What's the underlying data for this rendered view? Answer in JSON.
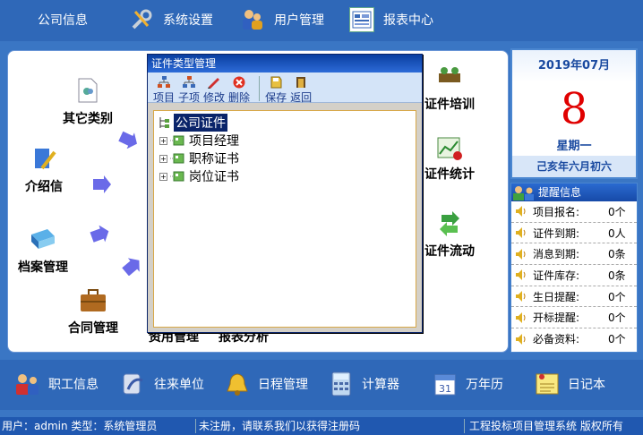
{
  "topnav": [
    {
      "label": "公司信息"
    },
    {
      "label": "系统设置"
    },
    {
      "label": "用户管理"
    },
    {
      "label": "报表中心"
    }
  ],
  "main": {
    "left_items": [
      {
        "label": "其它类别"
      },
      {
        "label": "介绍信"
      },
      {
        "label": "档案管理"
      },
      {
        "label": "合同管理"
      }
    ],
    "right_items": [
      {
        "label": "证件培训"
      },
      {
        "label": "证件统计"
      },
      {
        "label": "证件流动"
      }
    ],
    "bg_labels": {
      "b1": "资用管理",
      "b2": "报表分析"
    }
  },
  "dialog": {
    "title": "证件类型管理",
    "toolbar": {
      "item": "项目",
      "subitem": "子项",
      "edit": "修改",
      "delete": "删除",
      "save": "保存",
      "back": "返回"
    },
    "tree": {
      "root": "公司证件",
      "children": [
        {
          "label": "项目经理"
        },
        {
          "label": "职称证书"
        },
        {
          "label": "岗位证书"
        }
      ]
    }
  },
  "calendar": {
    "year_month": "2019年07月",
    "day": "8",
    "weekday": "星期一",
    "lunar": "己亥年六月初六"
  },
  "reminders": {
    "title": "提醒信息",
    "items": [
      {
        "label": "项目报名:",
        "count": "0个"
      },
      {
        "label": "证件到期:",
        "count": "0人"
      },
      {
        "label": "消息到期:",
        "count": "0条"
      },
      {
        "label": "证件库存:",
        "count": "0条"
      },
      {
        "label": "生日提醒:",
        "count": "0个"
      },
      {
        "label": "开标提醒:",
        "count": "0个"
      },
      {
        "label": "必备资料:",
        "count": "0个"
      }
    ]
  },
  "bottomnav": [
    {
      "label": "职工信息"
    },
    {
      "label": "往来单位"
    },
    {
      "label": "日程管理"
    },
    {
      "label": "计算器"
    },
    {
      "label": "万年历"
    },
    {
      "label": "日记本"
    }
  ],
  "status": {
    "user": "用户：admin 类型：系统管理员",
    "register": "未注册，请联系我们以获得注册码",
    "product": "工程投标项目管理系统 版权所有"
  },
  "colors": {
    "bar": "#2f68b8",
    "accent": "#e00000",
    "title_blue": "#1a4aa0"
  }
}
